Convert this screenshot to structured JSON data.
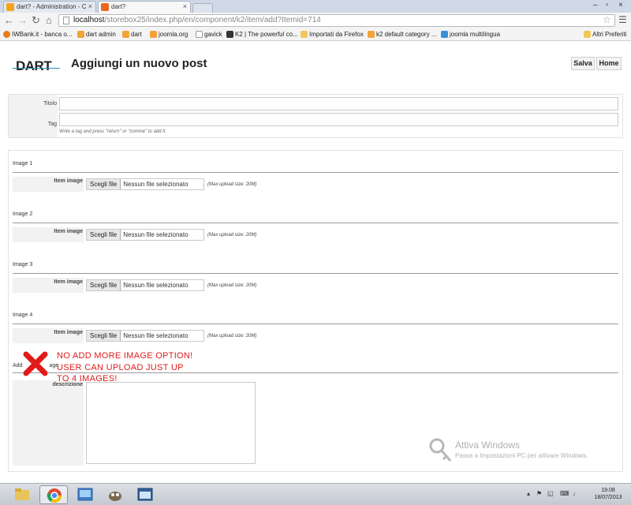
{
  "browser": {
    "tabs": [
      {
        "label": "dart? - Administration - C",
        "close": "×"
      },
      {
        "label": "dart?",
        "close": "×"
      }
    ],
    "url_host": "localhost",
    "url_path": "/storebox25/index.php/en/component/k2/item/add?Itemid=714",
    "bookmarks": [
      "IWBank.it - banca o...",
      "dart admin",
      "dart",
      "joomla.org",
      "gavick",
      "K2 | The powerful co...",
      "Importati da Firefox",
      "k2 default category ...",
      "joomla multilingua"
    ],
    "other_bookmarks": "Altri Preferiti",
    "window_controls": {
      "minimize": "–",
      "maximize": "▫",
      "close": "×"
    }
  },
  "header": {
    "logo": "DART",
    "title": "Aggiungi un nuovo post",
    "save_label": "Salva",
    "home_label": "Home"
  },
  "form": {
    "title_label": "Titolo",
    "tag_label": "Tag",
    "tag_hint": "Write a tag and press \"return\" or \"comme\" to add it.",
    "images": [
      {
        "header": "Image 1",
        "label": "Item image",
        "button": "Scegli file",
        "file": "Nessun file selezionato",
        "max": "(Max upload size: 20M)"
      },
      {
        "header": "Image 2",
        "label": "Item image",
        "button": "Scegli file",
        "file": "Nessun file selezionato",
        "max": "(Max upload size: 20M)"
      },
      {
        "header": "Image 3",
        "label": "Item image",
        "button": "Scegli file",
        "file": "Nessun file selezionato",
        "max": "(Max upload size: 20M)"
      },
      {
        "header": "Image 4",
        "label": "Item image",
        "button": "Scegli file",
        "file": "Nessun file selezionato",
        "max": "(Max upload size: 20M)"
      }
    ],
    "add_image_label_start": "Add",
    "add_image_label_end": "age",
    "description_label": "descrizione"
  },
  "annotation": {
    "line1": "NO ADD MORE IMAGE OPTION!",
    "line2": "USER CAN UPLOAD JUST UP",
    "line3": "TO 4 IMAGES!",
    "color": "#e01b1b"
  },
  "watermark": {
    "title": "Attiva Windows",
    "subtitle": "Passa a Impostazioni PC per attivare Windows."
  },
  "taskbar": {
    "time": "19.08",
    "date": "18/07/2013"
  }
}
